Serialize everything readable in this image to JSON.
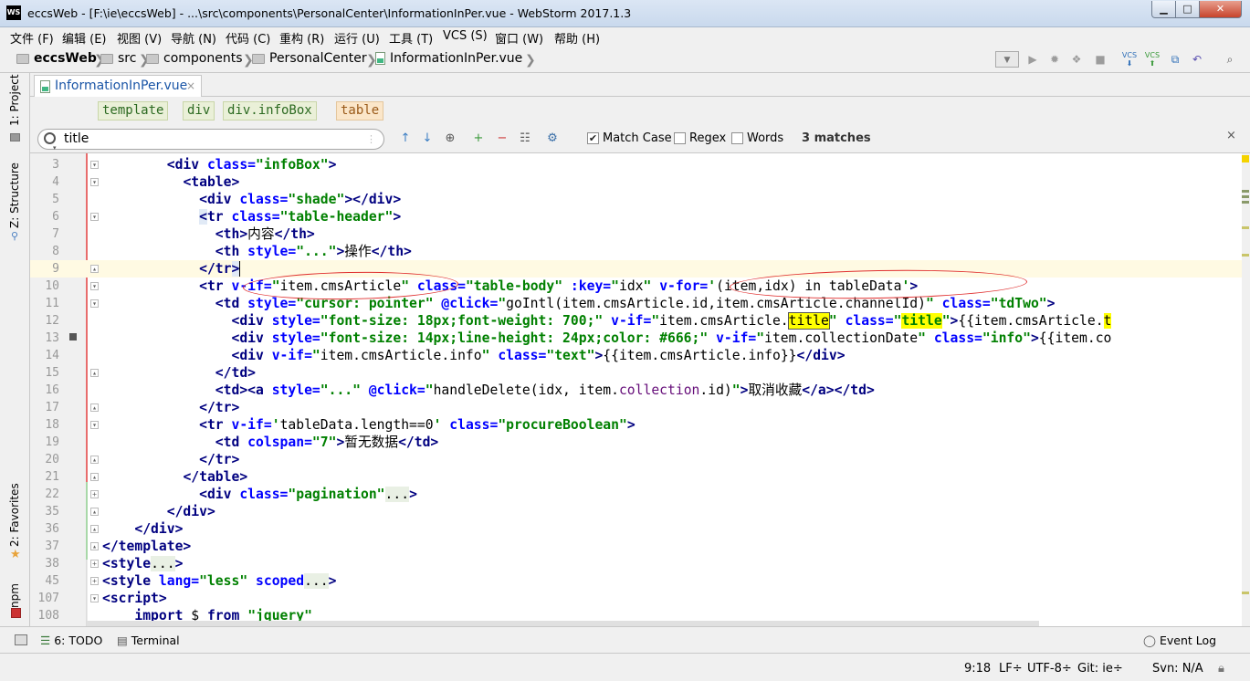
{
  "window": {
    "title": "eccsWeb - [F:\\ie\\eccsWeb] - ...\\src\\components\\PersonalCenter\\InformationInPer.vue - WebStorm 2017.1.3",
    "app_icon_text": "WS",
    "min_glyph": "▁",
    "max_glyph": "□",
    "close_glyph": "✕"
  },
  "menu": [
    "文件 (F)",
    "编辑 (E)",
    "视图 (V)",
    "导航 (N)",
    "代码 (C)",
    "重构 (R)",
    "运行 (U)",
    "工具 (T)",
    "VCS (S)",
    "窗口 (W)",
    "帮助 (H)"
  ],
  "breadcrumb": [
    "eccsWeb",
    "src",
    "components",
    "PersonalCenter",
    "InformationInPer.vue"
  ],
  "side_panels": {
    "project": "1: Project",
    "structure": "Z: Structure",
    "favorites": "2: Favorites",
    "npm": "npm"
  },
  "editor_tab": {
    "label": "InformationInPer.vue",
    "close": "×"
  },
  "tag_path": [
    "template",
    "div",
    "div.infoBox",
    "table"
  ],
  "search": {
    "value": "title",
    "options": [
      {
        "label": "Match Case",
        "checked": true
      },
      {
        "label": "Regex",
        "checked": false
      },
      {
        "label": "Words",
        "checked": false
      }
    ],
    "result": "3 matches",
    "close": "×"
  },
  "line_numbers": [
    "3",
    "4",
    "5",
    "6",
    "7",
    "8",
    "9",
    "10",
    "11",
    "12",
    "13",
    "14",
    "15",
    "16",
    "17",
    "18",
    "19",
    "20",
    "21",
    "22",
    "35",
    "36",
    "37",
    "38",
    "45",
    "107",
    "108"
  ],
  "cursor": "9:18",
  "bottom_tabs": {
    "todo": "6: TODO",
    "terminal": "Terminal",
    "event_log": "Event Log"
  },
  "status": {
    "position": "9:18",
    "line_sep": "LF÷",
    "encoding": "UTF-8÷",
    "git": "Git: ie÷",
    "svn": "Svn: N/A"
  },
  "colors": {
    "tag": "#000080",
    "attr": "#0000ff",
    "value": "#008000",
    "highlight": "#ffff00",
    "current_line": "#fffae3"
  }
}
